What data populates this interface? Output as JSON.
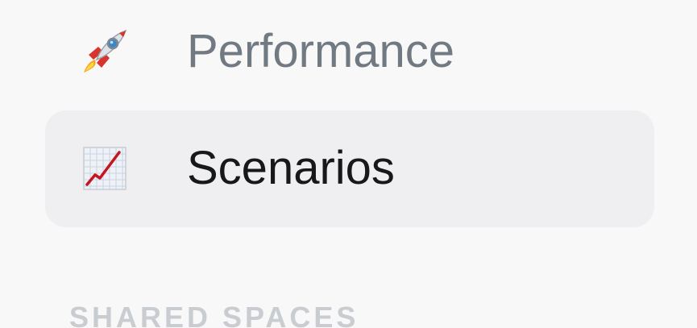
{
  "nav": {
    "items": [
      {
        "label": "Performance",
        "icon": "rocket-icon",
        "active": false
      },
      {
        "label": "Scenarios",
        "icon": "chart-increasing-icon",
        "active": true
      }
    ]
  },
  "sections": {
    "shared_spaces_title": "SHARED SPACES"
  },
  "colors": {
    "background": "#f8f8f8",
    "active_item_bg": "#efeff1",
    "inactive_text": "#717a82",
    "active_text": "#17181a",
    "section_title": "#c9ccd0"
  }
}
